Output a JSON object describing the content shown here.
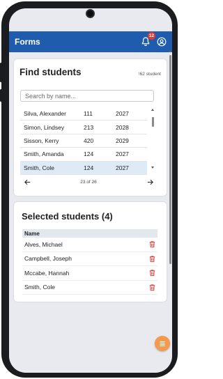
{
  "app": {
    "title": "Forms",
    "notification_count": "12"
  },
  "find": {
    "title": "Find students",
    "count": "!62 student",
    "search_placeholder": "Search by name...",
    "rows": [
      {
        "name": "Silva, Alexander",
        "room": "111",
        "year": "2027",
        "selected": false
      },
      {
        "name": "Simon, Lindsey",
        "room": "213",
        "year": "2028",
        "selected": false
      },
      {
        "name": "Sisson, Kerry",
        "room": "420",
        "year": "2029",
        "selected": false
      },
      {
        "name": "Smith, Amanda",
        "room": "124",
        "year": "2027",
        "selected": false
      },
      {
        "name": "Smith, Cole",
        "room": "124",
        "year": "2027",
        "selected": true
      }
    ],
    "page_label": "23 of 26"
  },
  "selected": {
    "title": "Selected students (4)",
    "column_name": "Name",
    "rows": [
      {
        "name": "Alves, Michael"
      },
      {
        "name": "Campbell, Joseph"
      },
      {
        "name": "Mccabe, Hannah"
      },
      {
        "name": "Smith, Cole"
      }
    ]
  },
  "colors": {
    "appbar": "#1f5cad",
    "badge": "#e53935",
    "selected_row": "#deebf7",
    "trash": "#e53935",
    "fab": "#f39a4e"
  },
  "icons": {
    "bell": "bell-icon",
    "user": "user-circle-icon",
    "prev": "arrow-left-icon",
    "next": "arrow-right-icon",
    "delete": "trash-icon",
    "fab": "list-icon"
  }
}
